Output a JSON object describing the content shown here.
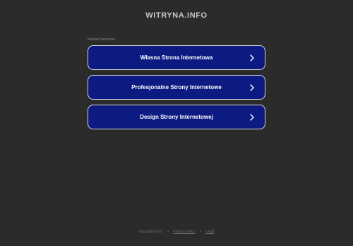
{
  "header": {
    "site_title": "WITRYNA.INFO"
  },
  "related": {
    "label": "Related searches",
    "items": [
      {
        "label": "Własna Strona Internetowa"
      },
      {
        "label": "Profesjonalne Strony Internetowe"
      },
      {
        "label": "Design Strony Internetowej"
      }
    ],
    "button_color": "#0d1a82",
    "icon": "chevron-right-icon"
  },
  "footer": {
    "copyright": "Copyright 2021",
    "separator": "•",
    "privacy_link": "Privacy Policy",
    "legal_link": "Legal"
  },
  "colors": {
    "background": "#2b2b2b",
    "button": "#0d1a82"
  }
}
